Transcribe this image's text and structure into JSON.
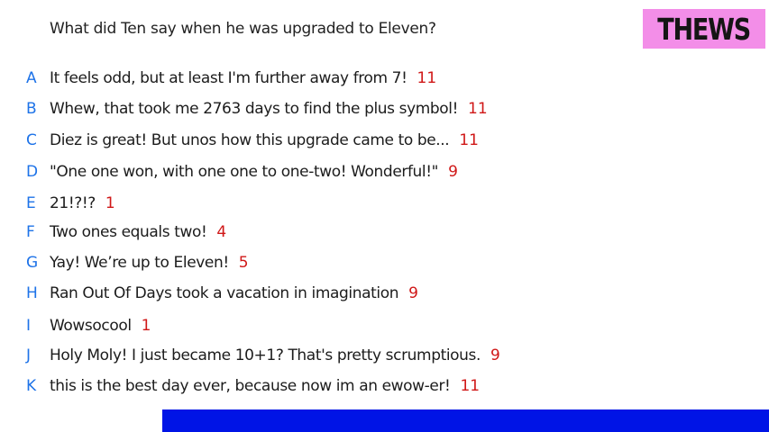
{
  "question": "What did Ten say when he was upgraded to Eleven?",
  "logo": "THEWS",
  "answers": [
    {
      "letter": "A",
      "text": "It feels odd, but at least I'm further away from 7!",
      "score": "11"
    },
    {
      "letter": "B",
      "text": "Whew, that took me 2763 days to find the plus symbol!",
      "score": "11"
    },
    {
      "letter": "C",
      "text": "Diez is great! But unos how this upgrade came to be...",
      "score": "11"
    },
    {
      "letter": "D",
      "text": "\"One one won, with one one to one-two! Wonderful!\"",
      "score": "9"
    },
    {
      "letter": "E",
      "text": "21!?!?",
      "score": "1"
    },
    {
      "letter": "F",
      "text": "Two ones equals two!",
      "score": "4"
    },
    {
      "letter": "G",
      "text": "Yay! We’re up to Eleven!",
      "score": "5"
    },
    {
      "letter": "H",
      "text": "Ran Out Of Days took a vacation in imagination",
      "score": "9"
    },
    {
      "letter": "I",
      "text": "Wowsocool",
      "score": "1"
    },
    {
      "letter": "J",
      "text": "Holy Moly! I just became 10+1? That's pretty scrumptious.",
      "score": "9"
    },
    {
      "letter": "K",
      "text": "this is the best day ever, because now im an ewow-er!",
      "score": "11"
    }
  ],
  "colors": {
    "letter": "#1e73e8",
    "score": "#d01818",
    "logo_bg": "#f38ee8",
    "bottom_bar": "#0014e6"
  }
}
